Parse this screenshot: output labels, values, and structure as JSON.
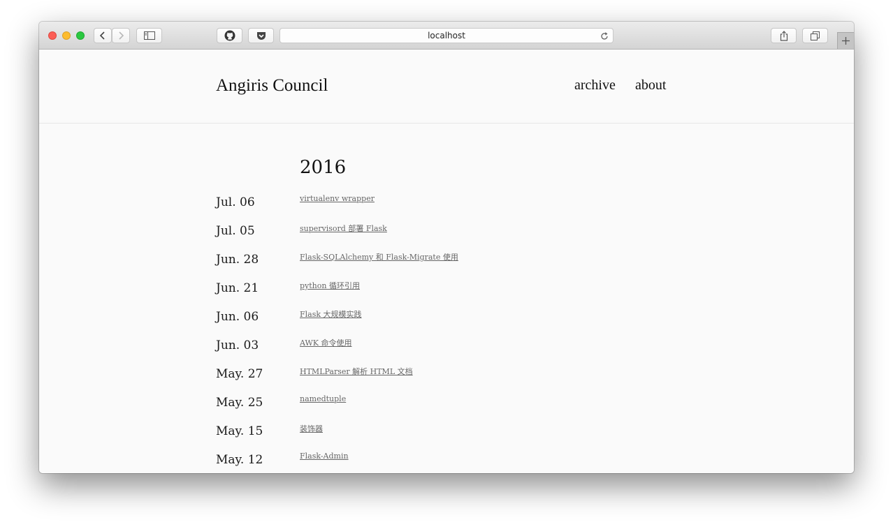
{
  "browser": {
    "url": "localhost",
    "icons": {
      "back": "chevron-left-icon",
      "forward": "chevron-right-icon",
      "sidebar": "sidebar-icon",
      "github": "github-icon",
      "pocket": "pocket-icon",
      "reload": "reload-icon",
      "share": "share-icon",
      "tabs": "tabs-overview-icon",
      "new_tab": "plus-icon"
    }
  },
  "site": {
    "title": "Angiris Council",
    "nav": [
      {
        "label": "archive"
      },
      {
        "label": "about"
      }
    ]
  },
  "archive": {
    "year": "2016",
    "posts": [
      {
        "date": "Jul. 06",
        "title": "virtualenv wrapper"
      },
      {
        "date": "Jul. 05",
        "title": "supervisord 部署 Flask"
      },
      {
        "date": "Jun. 28",
        "title": "Flask-SQLAlchemy 和 Flask-Migrate 使用"
      },
      {
        "date": "Jun. 21",
        "title": "python 循环引用"
      },
      {
        "date": "Jun. 06",
        "title": "Flask 大规模实践"
      },
      {
        "date": "Jun. 03",
        "title": "AWK 命令使用"
      },
      {
        "date": "May. 27",
        "title": "HTMLParser 解析 HTML 文档"
      },
      {
        "date": "May. 25",
        "title": "namedtuple"
      },
      {
        "date": "May. 15",
        "title": "装饰器"
      },
      {
        "date": "May. 12",
        "title": "Flask-Admin"
      }
    ]
  },
  "colors": {
    "background": "#fafafa",
    "text": "#111111",
    "link": "#666666",
    "toolbar": "#dcdcdc"
  }
}
